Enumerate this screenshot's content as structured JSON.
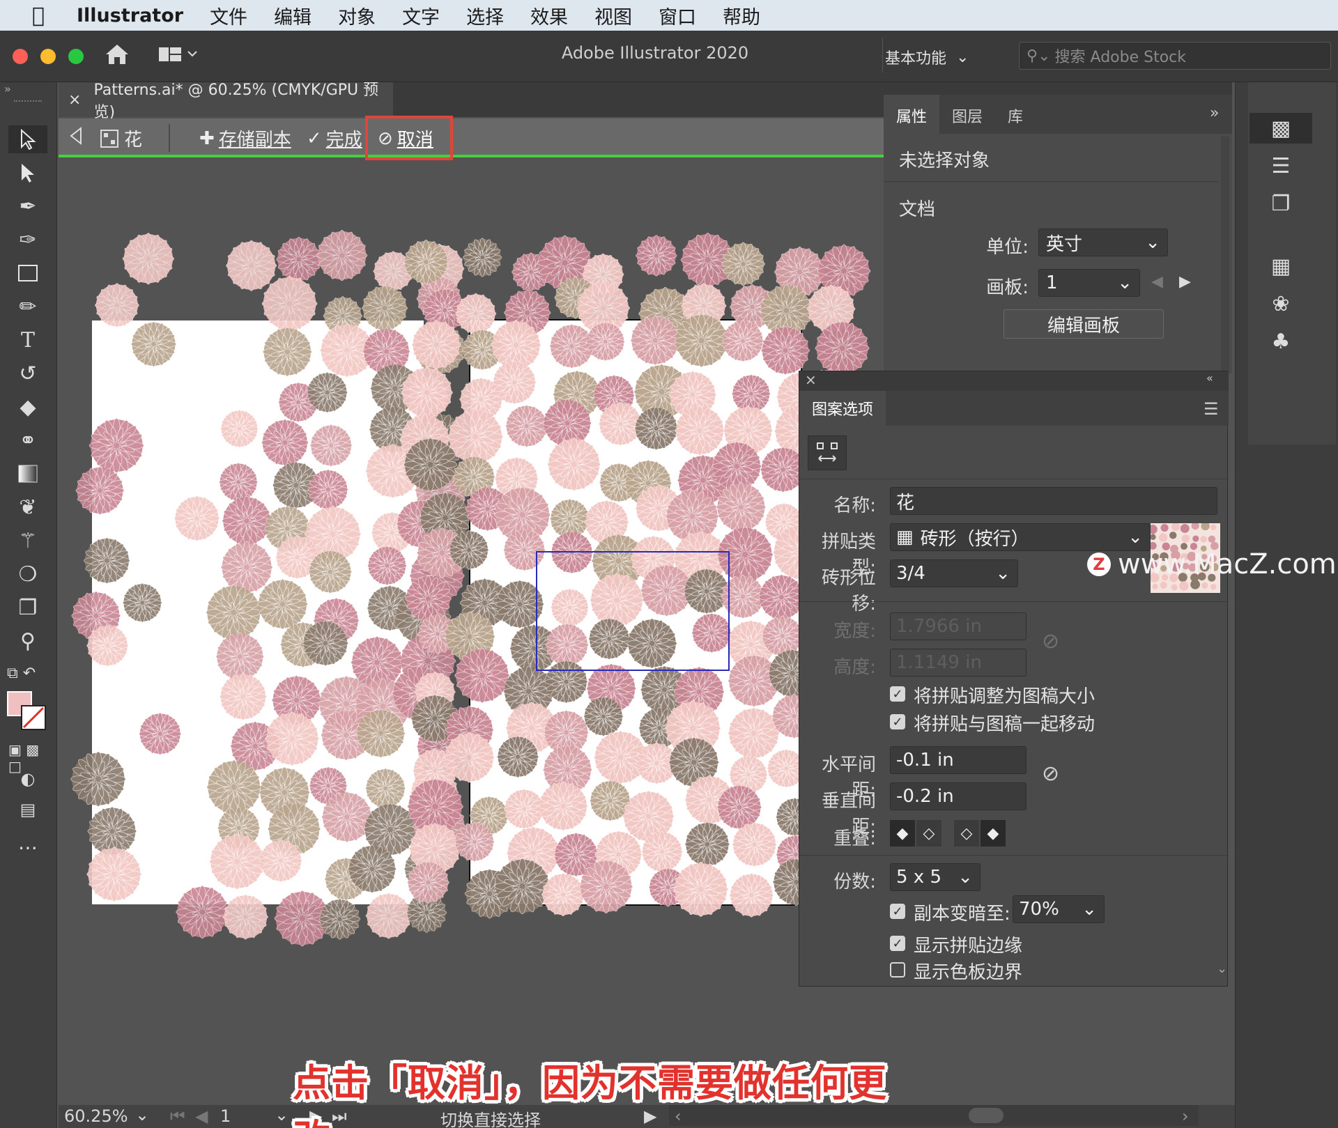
{
  "menubar": {
    "apple": "",
    "app": "Illustrator",
    "items": [
      "文件",
      "编辑",
      "对象",
      "文字",
      "选择",
      "效果",
      "视图",
      "窗口",
      "帮助"
    ]
  },
  "titlebar": {
    "title": "Adobe Illustrator 2020",
    "workspace": "基本功能",
    "search_placeholder": "搜索 Adobe Stock"
  },
  "document_tab": {
    "close": "×",
    "label": "Patterns.ai* @ 60.25% (CMYK/GPU 预览)"
  },
  "pattern_bar": {
    "pattern_name": "花",
    "save_copy": "存储副本",
    "done": "完成",
    "cancel": "取消"
  },
  "properties_panel": {
    "tabs": [
      "属性",
      "图层",
      "库"
    ],
    "no_selection": "未选择对象",
    "document_heading": "文档",
    "units_label": "单位:",
    "units_value": "英寸",
    "artboard_label": "画板:",
    "artboard_value": "1",
    "edit_artboards": "编辑画板"
  },
  "pattern_options": {
    "title": "图案选项",
    "name_label": "名称:",
    "name_value": "花",
    "tile_type_label": "拼贴类型:",
    "tile_type_value": "砖形（按行）",
    "brick_offset_label": "砖形位移:",
    "brick_offset_value": "3/4",
    "width_label": "宽度:",
    "width_value": "1.7966 in",
    "height_label": "高度:",
    "height_value": "1.1149 in",
    "size_tile_to_art": "将拼贴调整为图稿大小",
    "move_tile_with_art": "将拼贴与图稿一起移动",
    "h_spacing_label": "水平间距:",
    "h_spacing_value": "-0.1 in",
    "v_spacing_label": "垂直间距:",
    "v_spacing_value": "-0.2 in",
    "overlap_label": "重叠:",
    "copies_label": "份数:",
    "copies_value": "5 x 5",
    "dim_copies_label": "副本变暗至:",
    "dim_copies_value": "70%",
    "show_tile_edge": "显示拼贴边缘",
    "show_swatch_bounds": "显示色板边界",
    "checks": {
      "size_tile_to_art": true,
      "move_tile_with_art": true,
      "dim_copies": true,
      "show_tile_edge": true,
      "show_swatch_bounds": false
    }
  },
  "statusbar": {
    "zoom": "60.25%",
    "artboard": "1",
    "tool_hint": "切换直接选择"
  },
  "caption": "点击「取消」，因为不需要做任何更改",
  "watermark": "www.MacZ.com",
  "colors": {
    "flower_dark": "#8a7a6c",
    "flower_tan": "#b9a48c",
    "flower_rose": "#d7a0a6",
    "flower_pink": "#f2c6c2",
    "flower_mauve": "#c98593",
    "edit_green": "#45d13a",
    "highlight_red": "#e0453b"
  }
}
